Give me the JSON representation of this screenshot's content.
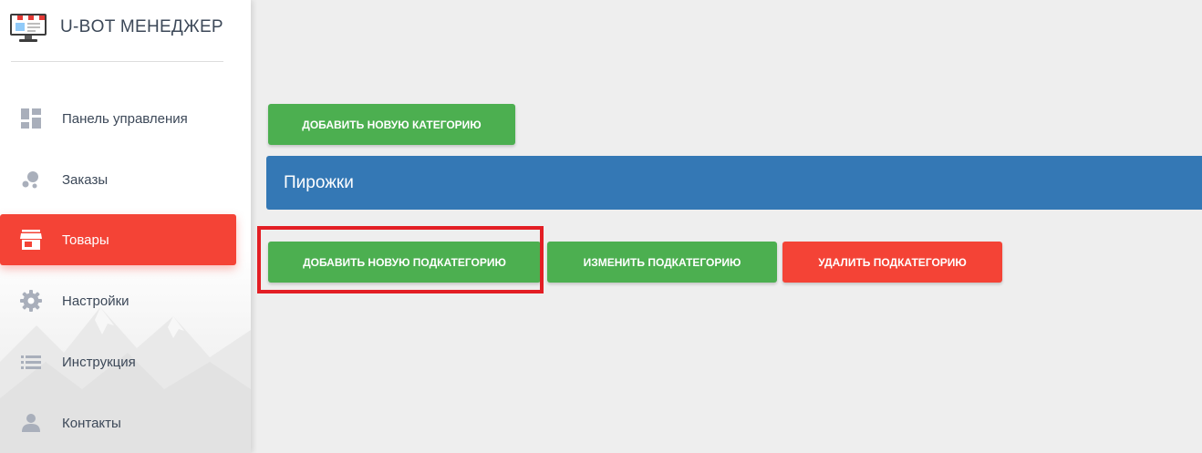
{
  "brand": {
    "title": "U-BOT МЕНЕДЖЕР",
    "logo_icon": "shop-monitor-icon"
  },
  "sidebar": {
    "items": [
      {
        "label": "Панель управления",
        "icon": "dashboard-icon",
        "active": false
      },
      {
        "label": "Заказы",
        "icon": "bubble-chart-icon",
        "active": false
      },
      {
        "label": "Товары",
        "icon": "store-icon",
        "active": true
      },
      {
        "label": "Настройки",
        "icon": "gear-icon",
        "active": false
      },
      {
        "label": "Инструкция",
        "icon": "list-icon",
        "active": false
      },
      {
        "label": "Контакты",
        "icon": "person-icon",
        "active": false
      }
    ]
  },
  "main": {
    "add_category_label": "ДОБАВИТЬ НОВУЮ КАТЕГОРИЮ",
    "category": {
      "name": "Пирожки"
    },
    "add_subcategory_label": "ДОБАВИТЬ НОВУЮ ПОДКАТЕГОРИЮ",
    "edit_subcategory_label": "ИЗМЕНИТЬ ПОДКАТЕГОРИЮ",
    "delete_subcategory_label": "УДАЛИТЬ ПОДКАТЕГОРИЮ"
  },
  "colors": {
    "accent_red": "#f44336",
    "success_green": "#4caf50",
    "category_blue": "#3478b5",
    "highlight_red": "#e31e24"
  }
}
